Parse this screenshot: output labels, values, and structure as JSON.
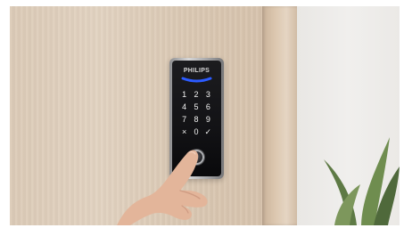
{
  "photo": {
    "brand_text": "PHILIPS",
    "keypad_keys": [
      "1",
      "2",
      "3",
      "4",
      "5",
      "6",
      "7",
      "8",
      "9",
      "×",
      "0",
      "✓"
    ]
  },
  "colors": {
    "door": "#dccbb7",
    "wall": "#f0efed",
    "lock_face": "#121215",
    "accent_blue": "#2c5bff",
    "skin": "#e3b59a"
  },
  "icons": {
    "fingerprint": "fingerprint-sensor-icon",
    "clear": "clear-icon",
    "confirm": "check-icon"
  }
}
